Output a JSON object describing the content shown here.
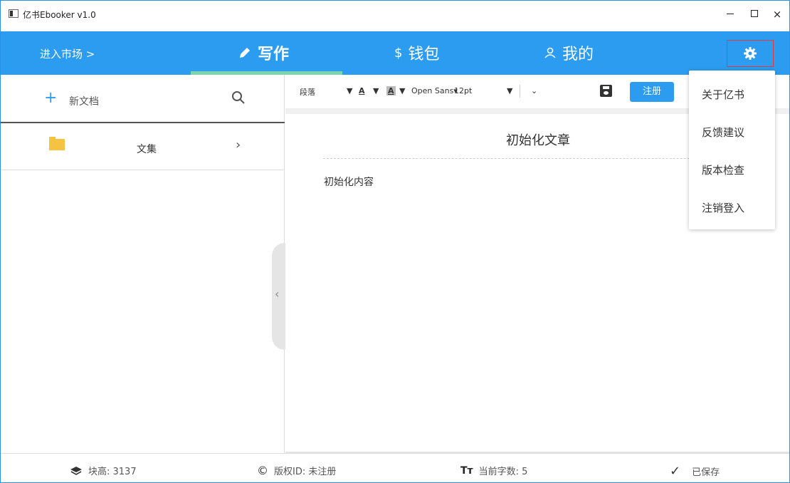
{
  "window": {
    "title": "亿书Ebooker v1.0",
    "min_label": "",
    "max_label": "",
    "close_label": "×"
  },
  "nav": {
    "market": "进入市场 >",
    "tabs": [
      {
        "label": "写作",
        "icon": "pencil-icon",
        "active": true
      },
      {
        "label": "钱包",
        "icon": "dollar-icon",
        "active": false
      },
      {
        "label": "我的",
        "icon": "user-icon",
        "active": false
      }
    ],
    "settings_icon": "gear-icon"
  },
  "sidebar": {
    "new_doc": "新文档",
    "folder_label": "文集"
  },
  "toolbar": {
    "paragraph": "段落",
    "text_color": "A",
    "bg_color": "A",
    "font": "Open Sans▾",
    "size": "12pt",
    "register": "注册"
  },
  "document": {
    "title": "初始化文章",
    "body": "初始化内容"
  },
  "menu": {
    "items": [
      "关于亿书",
      "反馈建议",
      "版本检查",
      "注销登入"
    ]
  },
  "status": {
    "block_height": "块高: 3137",
    "copyright_id": "版权ID: 未注册",
    "word_count": "当前字数: 5",
    "saved": "已保存"
  },
  "colors": {
    "accent": "#2c9cf0",
    "tab_underline": "#7ad5ae",
    "folder": "#f5c242",
    "highlight_border": "#e03c3c"
  }
}
